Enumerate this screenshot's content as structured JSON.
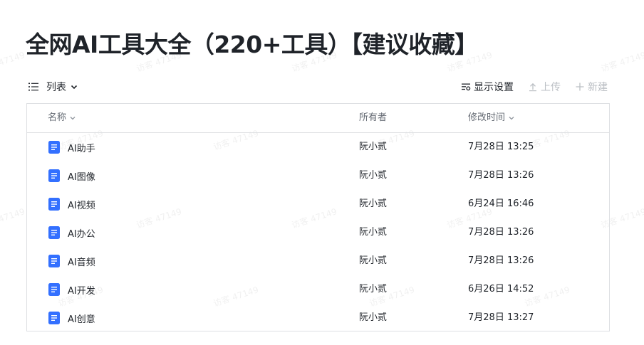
{
  "page": {
    "title": "全网AI工具大全（220+工具）【建议收藏】",
    "watermark": "访客 47149"
  },
  "toolbar": {
    "view_label": "列表",
    "display_settings_label": "显示设置",
    "upload_label": "上传",
    "new_label": "新建"
  },
  "table": {
    "headers": {
      "name": "名称",
      "owner": "所有者",
      "modified": "修改时间"
    },
    "rows": [
      {
        "name": "AI助手",
        "owner": "阮小贰",
        "modified": "7月28日 13:25"
      },
      {
        "name": "AI图像",
        "owner": "阮小贰",
        "modified": "7月28日 13:26"
      },
      {
        "name": "AI视频",
        "owner": "阮小贰",
        "modified": "6月24日 16:46"
      },
      {
        "name": "AI办公",
        "owner": "阮小贰",
        "modified": "7月28日 13:26"
      },
      {
        "name": "AI音频",
        "owner": "阮小贰",
        "modified": "7月28日 13:26"
      },
      {
        "name": "AI开发",
        "owner": "阮小贰",
        "modified": "6月26日 14:52"
      },
      {
        "name": "AI创意",
        "owner": "阮小贰",
        "modified": "7月28日 13:27"
      }
    ]
  },
  "colors": {
    "doc_icon": "#3370ff",
    "border": "#dee0e3",
    "muted": "#646a73",
    "disabled": "#bbbfc4"
  }
}
